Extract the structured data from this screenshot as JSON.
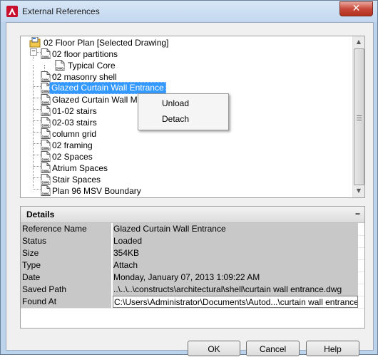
{
  "window": {
    "title": "External References",
    "close_glyph": "✕"
  },
  "tree": {
    "root": "02 Floor Plan [Selected Drawing]",
    "items": [
      {
        "label": "02 floor partitions",
        "expander": "−"
      },
      {
        "label": "Typical Core"
      },
      {
        "label": "02 masonry shell"
      },
      {
        "label": "Glazed Curtain Wall Entrance",
        "selected": true
      },
      {
        "label": "Glazed Curtain Wall Main"
      },
      {
        "label": "01-02 stairs"
      },
      {
        "label": "02-03 stairs"
      },
      {
        "label": "column grid"
      },
      {
        "label": "02 framing"
      },
      {
        "label": "02 Spaces"
      },
      {
        "label": "Atrium Spaces"
      },
      {
        "label": "Stair Spaces"
      },
      {
        "label": "Plan 96 MSV Boundary"
      }
    ],
    "icon_text": "DWG"
  },
  "context_menu": {
    "unload": "Unload",
    "detach": "Detach"
  },
  "details": {
    "title": "Details",
    "collapse_glyph": "−",
    "rows": [
      {
        "name": "Reference Name",
        "value": "Glazed Curtain Wall Entrance"
      },
      {
        "name": "Status",
        "value": "Loaded"
      },
      {
        "name": "Size",
        "value": "354KB"
      },
      {
        "name": "Type",
        "value": "Attach"
      },
      {
        "name": "Date",
        "value": "Monday, January 07, 2013  1:09:22 AM"
      },
      {
        "name": "Saved Path",
        "value": "..\\..\\..\\constructs\\architectural\\shell\\curtain wall entrance.dwg"
      },
      {
        "name": "Found At",
        "value": "C:\\Users\\Administrator\\Documents\\Autod...\\curtain wall entrance.dwg"
      }
    ]
  },
  "buttons": {
    "ok": "OK",
    "cancel": "Cancel",
    "help": "Help"
  },
  "colors": {
    "selection": "#3399ff",
    "titlebar": "#c2d7ef",
    "close": "#c7493a"
  }
}
